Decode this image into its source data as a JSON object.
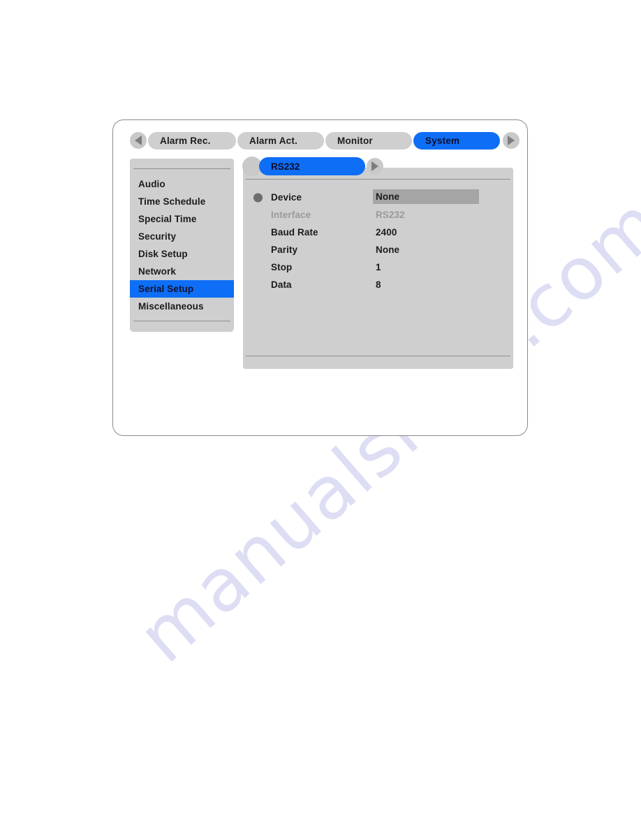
{
  "watermark": {
    "text": "manualshive.com",
    "color": "#c9c9ee"
  },
  "colors": {
    "accent_blue": "#0e6ef5",
    "panel_gray": "#cfcfcf",
    "tab_gray": "#cfcfcf",
    "nav_circle_gray": "#c9c9c9",
    "value_highlight_gray": "#a5a5a5",
    "dim_text": "#9a9a9a",
    "text": "#1b1b1b",
    "rule": "#8f8f8f",
    "window_border": "#8a8a8a"
  },
  "tabstrip": {
    "prev_icon": "triangle-left-icon",
    "next_icon": "triangle-right-icon",
    "tabs": [
      {
        "label": "Alarm Rec.",
        "selected": false
      },
      {
        "label": "Alarm Act.",
        "selected": false
      },
      {
        "label": "Monitor",
        "selected": false
      },
      {
        "label": "System",
        "selected": true
      }
    ]
  },
  "sidebar": {
    "items": [
      {
        "label": "Audio",
        "selected": false
      },
      {
        "label": "Time Schedule",
        "selected": false
      },
      {
        "label": "Special Time",
        "selected": false
      },
      {
        "label": "Security",
        "selected": false
      },
      {
        "label": "Disk Setup",
        "selected": false
      },
      {
        "label": "Network",
        "selected": false
      },
      {
        "label": "Serial Setup",
        "selected": true
      },
      {
        "label": "Miscellaneous",
        "selected": false
      }
    ]
  },
  "subtab": {
    "label": "RS232",
    "selected": true,
    "next_icon": "triangle-right-icon"
  },
  "settings": {
    "rows": [
      {
        "label": "Device",
        "value": "None",
        "bullet": true,
        "dim": false,
        "highlighted": true
      },
      {
        "label": "Interface",
        "value": "RS232",
        "bullet": false,
        "dim": true,
        "highlighted": false
      },
      {
        "label": "Baud Rate",
        "value": "2400",
        "bullet": false,
        "dim": false,
        "highlighted": false
      },
      {
        "label": "Parity",
        "value": "None",
        "bullet": false,
        "dim": false,
        "highlighted": false
      },
      {
        "label": "Stop",
        "value": "1",
        "bullet": false,
        "dim": false,
        "highlighted": false
      },
      {
        "label": "Data",
        "value": "8",
        "bullet": false,
        "dim": false,
        "highlighted": false
      }
    ]
  }
}
